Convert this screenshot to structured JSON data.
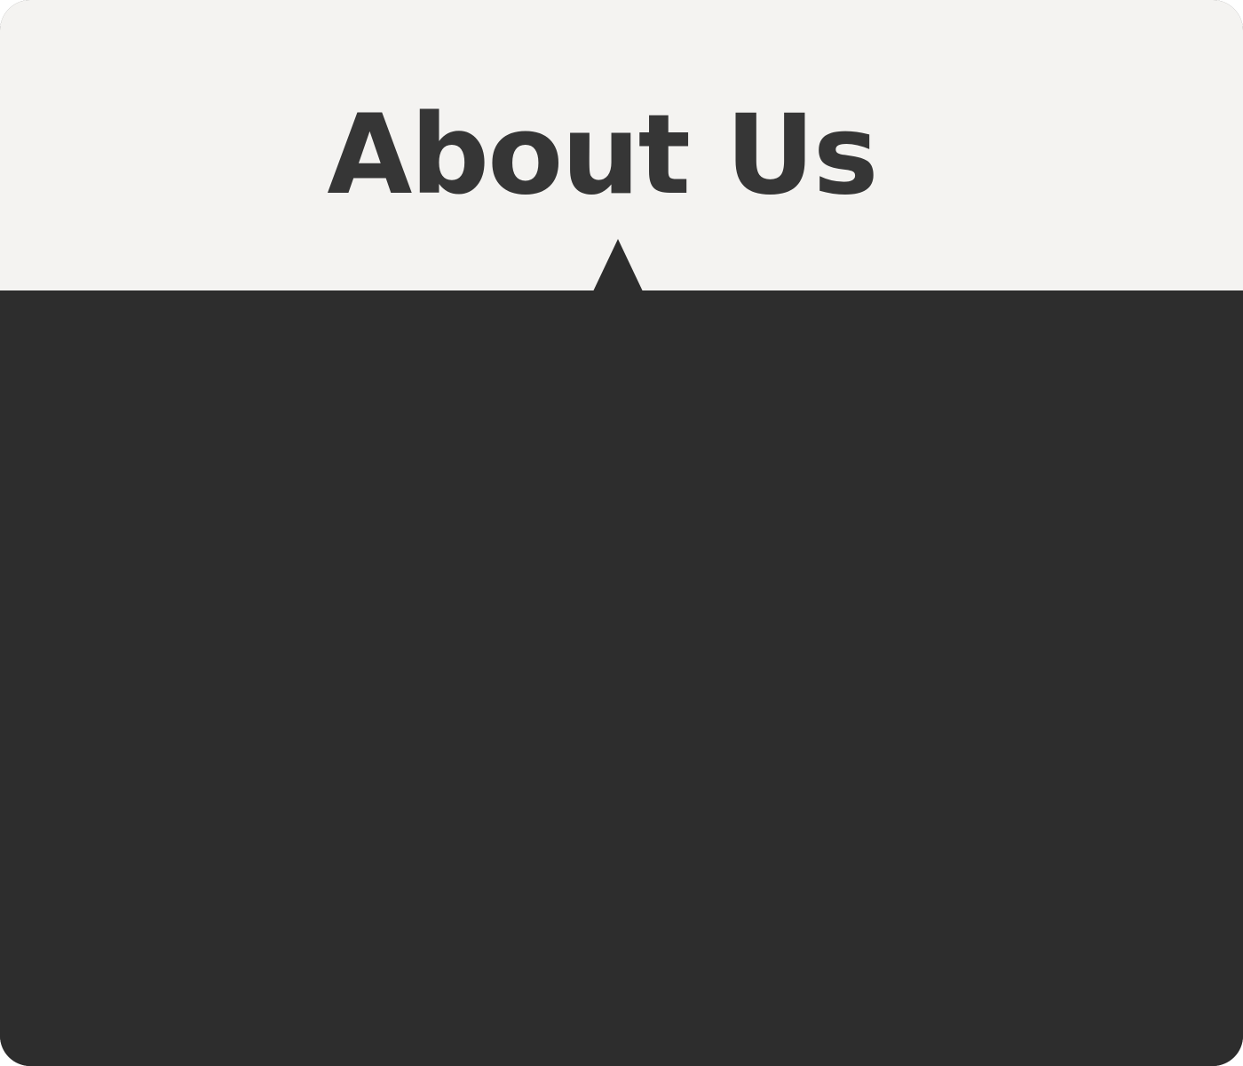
{
  "header": {
    "title": "About Us"
  },
  "colors": {
    "header_background": "#f4f3f1",
    "title_text": "#363636",
    "panel_background": "#2d2d2d"
  }
}
